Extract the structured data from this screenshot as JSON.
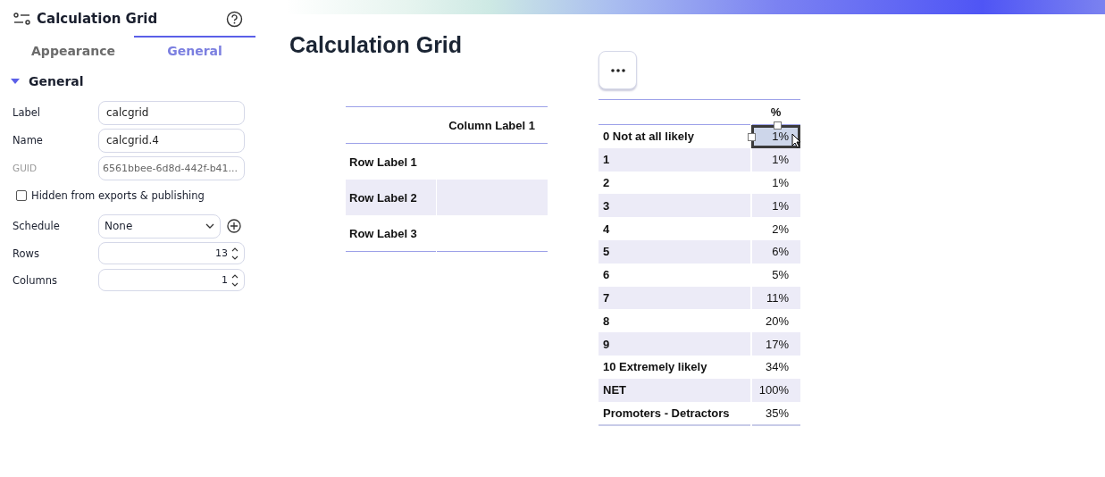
{
  "sidebar": {
    "title": "Calculation Grid",
    "tabs": [
      {
        "label": "Appearance",
        "selected": false
      },
      {
        "label": "General",
        "selected": true
      }
    ],
    "section": {
      "title": "General",
      "expanded": true
    },
    "fields": [
      {
        "label": "Label",
        "value": "calcgrid",
        "disabled": false
      },
      {
        "label": "Name",
        "value": "calcgrid.4",
        "disabled": false
      },
      {
        "label": "GUID",
        "value": "6561bbee-6d8d-442f-b41...",
        "disabled": true
      }
    ],
    "hidden_checkbox": {
      "label": "Hidden from exports & publishing",
      "checked": false
    },
    "schedule": {
      "label": "Schedule",
      "value": "None"
    },
    "rows": {
      "label": "Rows",
      "value": "13"
    },
    "columns": {
      "label": "Columns",
      "value": "1"
    }
  },
  "main": {
    "title": "Calculation Grid",
    "preview_table": {
      "columns": [
        "Column Label 1"
      ],
      "rows": [
        "Row Label 1",
        "Row Label 2",
        "Row Label 3"
      ]
    },
    "results_table": {
      "column": "%",
      "rows": [
        {
          "label": "0 Not at all likely",
          "value": "1%",
          "selected": true
        },
        {
          "label": "1",
          "value": "1%",
          "selected": false
        },
        {
          "label": "2",
          "value": "1%",
          "selected": false
        },
        {
          "label": "3",
          "value": "1%",
          "selected": false
        },
        {
          "label": "4",
          "value": "2%",
          "selected": false
        },
        {
          "label": "5",
          "value": "6%",
          "selected": false
        },
        {
          "label": "6",
          "value": "5%",
          "selected": false
        },
        {
          "label": "7",
          "value": "11%",
          "selected": false
        },
        {
          "label": "8",
          "value": "20%",
          "selected": false
        },
        {
          "label": "9",
          "value": "17%",
          "selected": false
        },
        {
          "label": "10 Extremely likely",
          "value": "34%",
          "selected": false
        },
        {
          "label": "NET",
          "value": "100%",
          "selected": false
        },
        {
          "label": "Promoters - Detractors",
          "value": "35%",
          "selected": false
        }
      ]
    }
  }
}
